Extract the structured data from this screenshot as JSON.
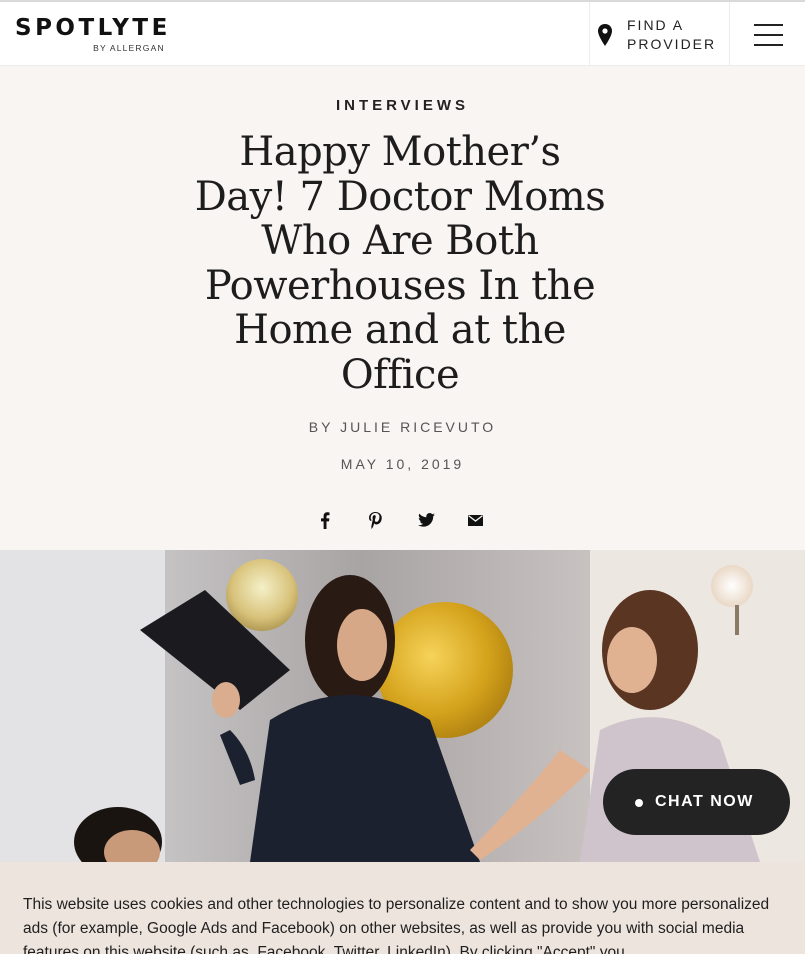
{
  "brand": {
    "name": "SPOTLYTE",
    "sub": "BY ALLERGAN"
  },
  "nav": {
    "find_provider_line1": "FIND A",
    "find_provider_line2": "PROVIDER",
    "pin_icon": "map-pin-icon",
    "menu_icon": "hamburger-menu-icon"
  },
  "article": {
    "category": "INTERVIEWS",
    "title": "Happy Mother’s Day! 7 Doctor Moms Who Are Both Powerhouses In the Home and at the Office",
    "byline": "BY JULIE RICEVUTO",
    "date": "MAY 10, 2019",
    "share_icons": [
      "facebook-icon",
      "pinterest-icon",
      "twitter-icon",
      "email-icon"
    ]
  },
  "chat": {
    "label": "CHAT NOW"
  },
  "cookie_banner": {
    "text": "This website uses cookies and other technologies to personalize content and to show you more personalized ads (for example, Google Ads and Facebook) on other websites, as well as provide you with social media features on this website (such as, Facebook, Twitter, LinkedIn). By clicking \"Accept\" you"
  },
  "colors": {
    "hero_bg": "#f9f5f2",
    "cookie_bg": "#ede4de",
    "chat_bg": "#232323",
    "text": "#1b1b1b"
  }
}
